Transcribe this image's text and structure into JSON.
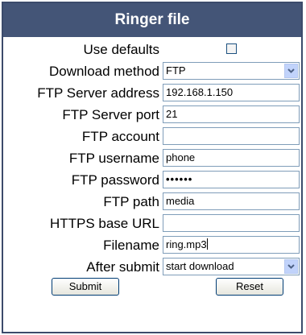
{
  "title": "Ringer file",
  "fields": {
    "use_defaults_label": "Use defaults",
    "download_method_label": "Download method",
    "download_method_value": "FTP",
    "ftp_server_address_label": "FTP Server address",
    "ftp_server_address_value": "192.168.1.150",
    "ftp_server_port_label": "FTP Server port",
    "ftp_server_port_value": "21",
    "ftp_account_label": "FTP account",
    "ftp_account_value": "",
    "ftp_username_label": "FTP username",
    "ftp_username_value": "phone",
    "ftp_password_label": "FTP password",
    "ftp_password_value": "••••••",
    "ftp_path_label": "FTP path",
    "ftp_path_value": "media",
    "https_base_url_label": "HTTPS base URL",
    "https_base_url_value": "",
    "filename_label": "Filename",
    "filename_value": "ring.mp3",
    "after_submit_label": "After submit",
    "after_submit_value": "start download"
  },
  "buttons": {
    "submit": "Submit",
    "reset": "Reset"
  }
}
